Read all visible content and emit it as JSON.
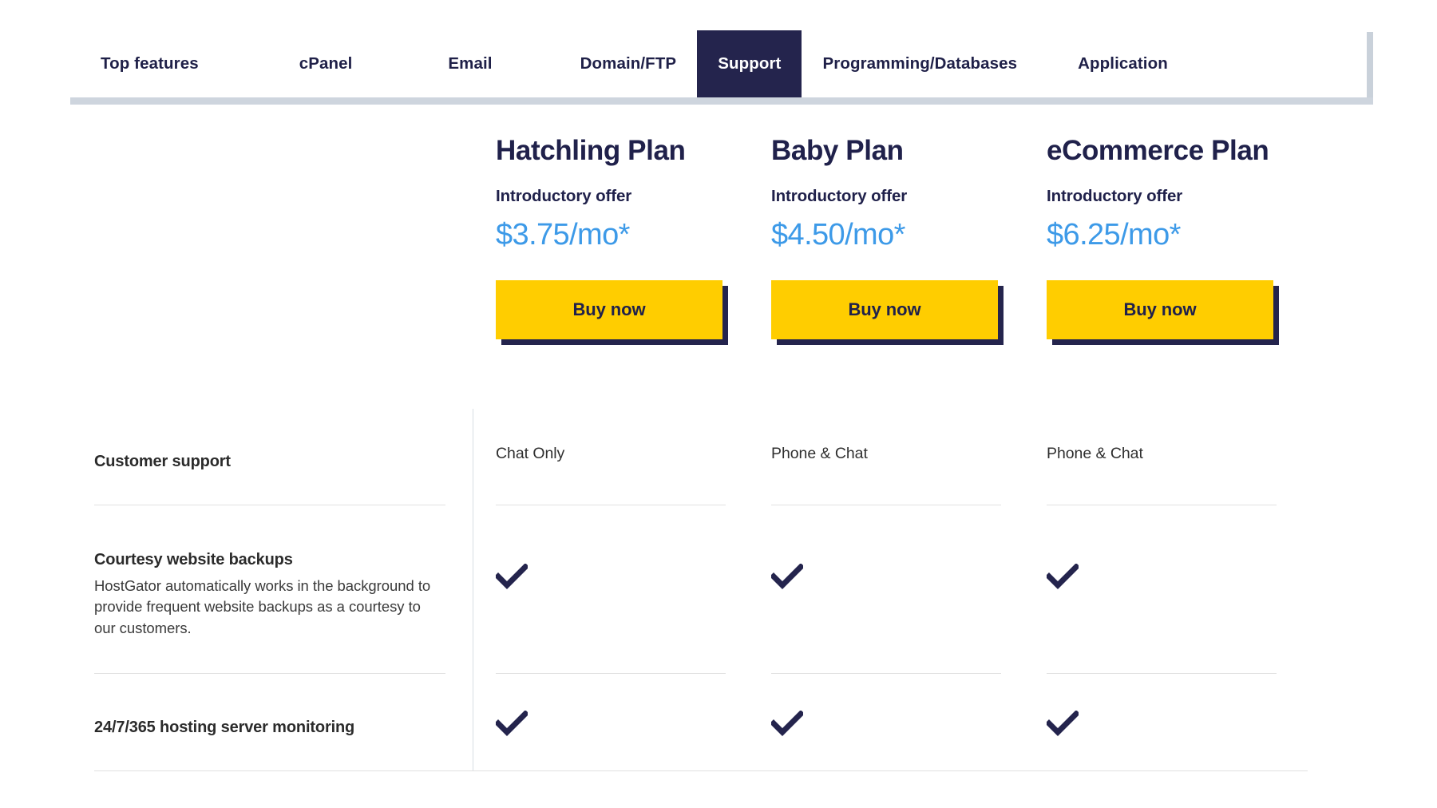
{
  "colors": {
    "navy": "#24244d",
    "price_blue": "#3d9ae8",
    "yellow": "#ffcd00",
    "tab_underline": "#ced5de",
    "rule": "#e2e2e2"
  },
  "tabs": {
    "items": [
      {
        "label": "Top features",
        "active": false
      },
      {
        "label": "cPanel",
        "active": false
      },
      {
        "label": "Email",
        "active": false
      },
      {
        "label": "Domain/FTP",
        "active": false
      },
      {
        "label": "Support",
        "active": true
      },
      {
        "label": "Programming/Databases",
        "active": false
      },
      {
        "label": "Application",
        "active": false
      }
    ],
    "active_label": "Support"
  },
  "plans": [
    {
      "name": "Hatchling Plan",
      "offer_label": "Introductory offer",
      "price": "$3.75/mo*",
      "cta": "Buy now"
    },
    {
      "name": "Baby Plan",
      "offer_label": "Introductory offer",
      "price": "$4.50/mo*",
      "cta": "Buy now"
    },
    {
      "name": "eCommerce Plan",
      "offer_label": "Introductory offer",
      "price": "$6.25/mo*",
      "cta": "Buy now"
    }
  ],
  "features": [
    {
      "title": "Customer support",
      "description": "",
      "values": [
        "Chat Only",
        "Phone & Chat",
        "Phone & Chat"
      ],
      "types": [
        "text",
        "text",
        "text"
      ]
    },
    {
      "title": "Courtesy website backups",
      "description": "HostGator automatically works in the background to provide frequent website backups as a courtesy to our customers.",
      "values": [
        "check",
        "check",
        "check"
      ],
      "types": [
        "check",
        "check",
        "check"
      ]
    },
    {
      "title": "24/7/365 hosting server monitoring",
      "description": "",
      "values": [
        "check",
        "check",
        "check"
      ],
      "types": [
        "check",
        "check",
        "check"
      ]
    }
  ],
  "icons": {
    "check": "check-icon"
  }
}
